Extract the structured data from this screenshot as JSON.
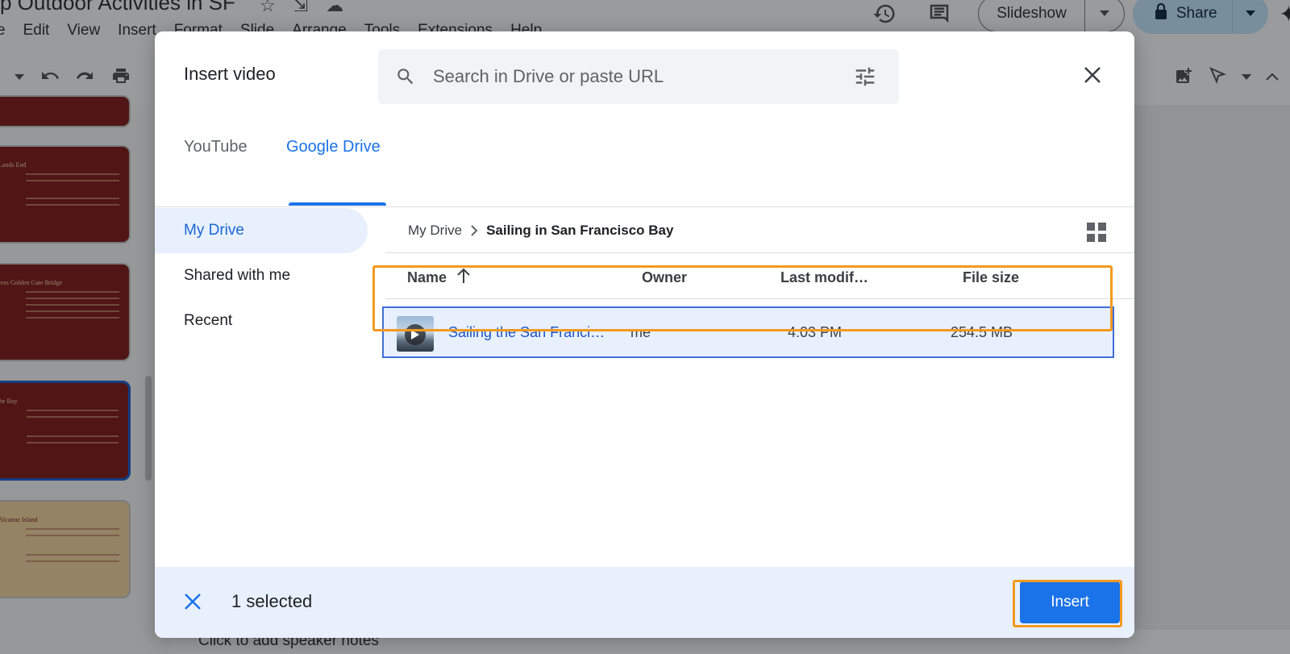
{
  "app": {
    "doc_title": "p Outdoor Activities in SF",
    "menu": [
      "e",
      "Edit",
      "View",
      "Insert",
      "Format",
      "Slide",
      "Arrange",
      "Tools",
      "Extensions",
      "Help"
    ],
    "slideshow_label": "Slideshow",
    "share_label": "Share",
    "speaker_notes": "Click to add speaker notes",
    "thumbnails": [
      {
        "title": "",
        "theme": "red"
      },
      {
        "title": "Lands End",
        "theme": "red"
      },
      {
        "title": "ross Golden Gate Bridge",
        "theme": "red"
      },
      {
        "title": "he Bay",
        "theme": "red"
      },
      {
        "title": "Alcatraz Island",
        "theme": "gold"
      }
    ]
  },
  "dialog": {
    "title": "Insert video",
    "search_placeholder": "Search in Drive or paste URL",
    "tabs": [
      {
        "label": "YouTube",
        "active": false
      },
      {
        "label": "Google Drive",
        "active": true
      }
    ],
    "nav": [
      {
        "label": "My Drive",
        "active": true
      },
      {
        "label": "Shared with me",
        "active": false
      },
      {
        "label": "Recent",
        "active": false
      }
    ],
    "breadcrumb": {
      "root": "My Drive",
      "current": "Sailing in San Francisco Bay"
    },
    "columns": {
      "name": "Name",
      "owner": "Owner",
      "modified": "Last modif…",
      "size": "File size"
    },
    "files": [
      {
        "name": "Sailing the San Francis…",
        "owner": "me",
        "modified": "4:03 PM",
        "size": "254.5 MB",
        "selected": true
      }
    ],
    "selected_text": "1 selected",
    "insert_label": "Insert"
  },
  "colors": {
    "accent": "#1a73e8",
    "highlight": "#f29a1f",
    "selected_row": "#e8f0fe"
  }
}
